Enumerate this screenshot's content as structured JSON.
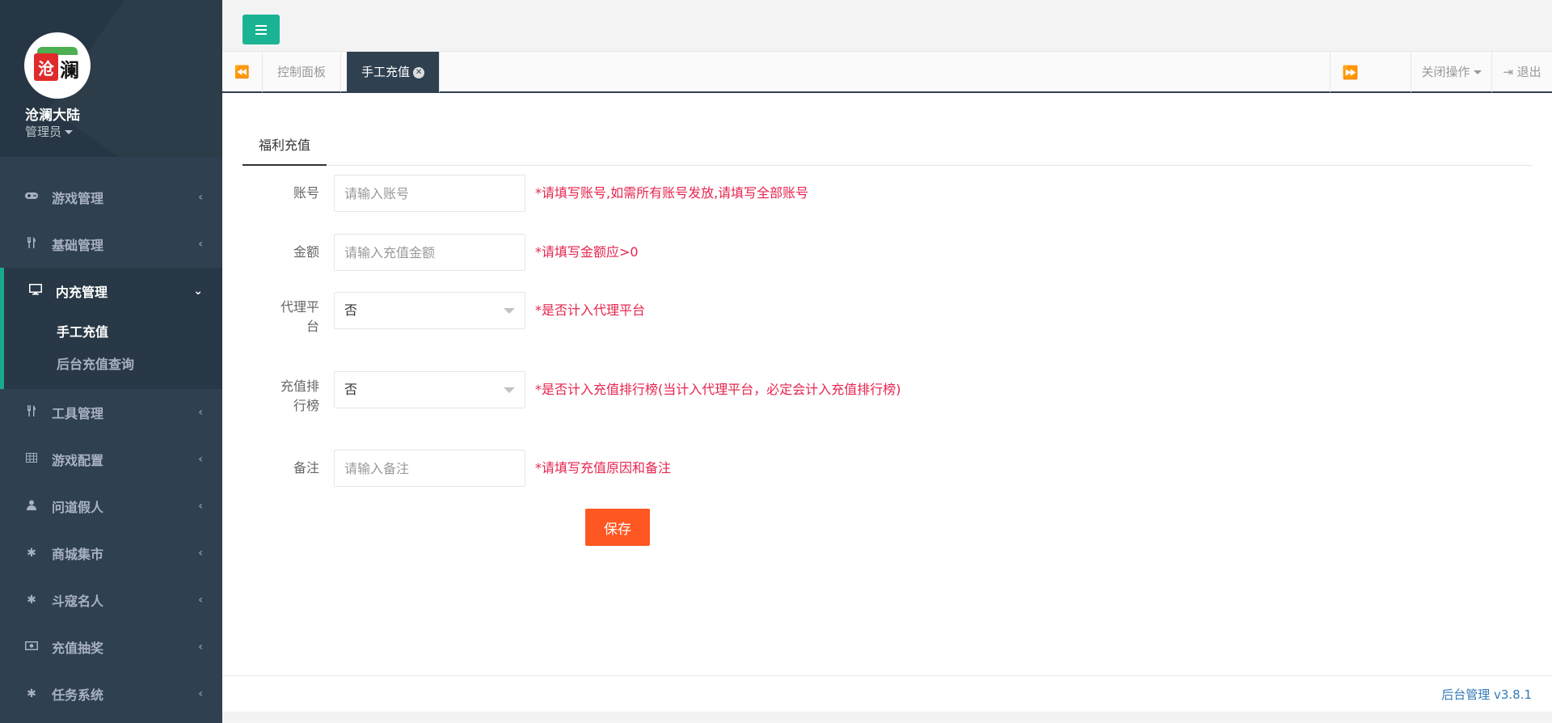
{
  "app": {
    "name": "沧澜大陆",
    "role": "管理员",
    "logo_text": [
      "沧",
      "澜"
    ]
  },
  "sidebar": {
    "items": [
      {
        "label": "游戏管理",
        "icon": "gamepad-icon"
      },
      {
        "label": "基础管理",
        "icon": "cutlery-icon"
      },
      {
        "label": "内充管理",
        "icon": "desktop-icon",
        "active": true,
        "children": [
          {
            "label": "手工充值",
            "active": true
          },
          {
            "label": "后台充值查询"
          }
        ]
      },
      {
        "label": "工具管理",
        "icon": "cutlery-icon"
      },
      {
        "label": "游戏配置",
        "icon": "table-icon"
      },
      {
        "label": "问道假人",
        "icon": "user-icon"
      },
      {
        "label": "商城集市",
        "icon": "asterisk-icon"
      },
      {
        "label": "斗寇名人",
        "icon": "asterisk-icon"
      },
      {
        "label": "充值抽奖",
        "icon": "money-icon"
      },
      {
        "label": "任务系统",
        "icon": "asterisk-icon"
      }
    ]
  },
  "tabs": {
    "items": [
      {
        "label": "控制面板"
      },
      {
        "label": "手工充值",
        "active": true
      }
    ],
    "close_ops": "关闭操作",
    "logout": "退出"
  },
  "form": {
    "tab": "福利充值",
    "fields": {
      "account": {
        "label": "账号",
        "placeholder": "请输入账号",
        "hint": "*请填写账号,如需所有账号发放,请填写全部账号"
      },
      "amount": {
        "label": "金额",
        "placeholder": "请输入充值金额",
        "hint": "*请填写金额应>0"
      },
      "agent": {
        "label_line1": "代理平",
        "label_line2": "台",
        "value": "否",
        "hint": "*是否计入代理平台"
      },
      "rank": {
        "label_line1": "充值排",
        "label_line2": "行榜",
        "value": "否",
        "hint": "*是否计入充值排行榜(当计入代理平台，必定会计入充值排行榜)"
      },
      "remark": {
        "label": "备注",
        "placeholder": "请输入备注",
        "hint": "*请填写充值原因和备注"
      }
    },
    "save_label": "保存"
  },
  "footer": {
    "version": "后台管理 v3.8.1"
  },
  "colors": {
    "sidebar_bg": "#2f4050",
    "accent": "#1ab394",
    "save_button": "#ff5722",
    "hint": "#e6254e"
  }
}
